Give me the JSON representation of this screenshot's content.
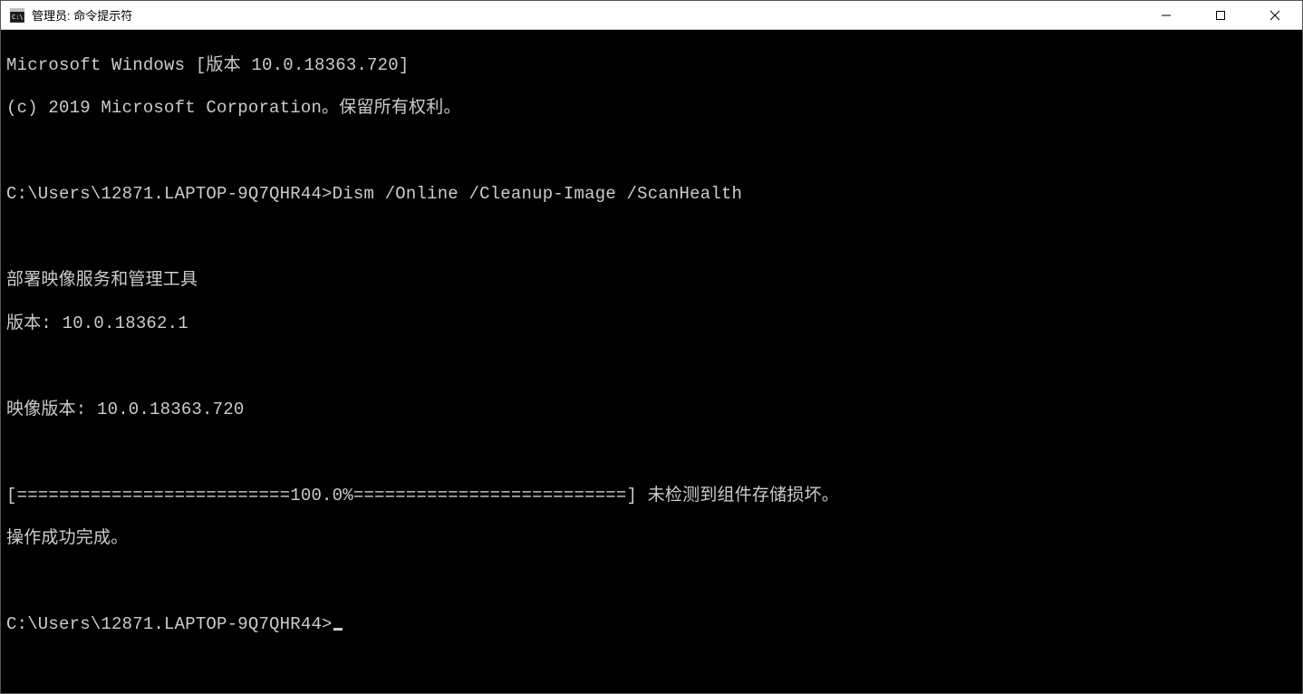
{
  "titlebar": {
    "title": "管理员: 命令提示符"
  },
  "terminal": {
    "lines": {
      "l0": "Microsoft Windows [版本 10.0.18363.720]",
      "l1": "(c) 2019 Microsoft Corporation。保留所有权利。",
      "l2": "",
      "l3_prompt": "C:\\Users\\12871.LAPTOP-9Q7QHR44>",
      "l3_cmd": "Dism /Online /Cleanup-Image /ScanHealth",
      "l4": "",
      "l5": "部署映像服务和管理工具",
      "l6": "版本: 10.0.18362.1",
      "l7": "",
      "l8": "映像版本: 10.0.18363.720",
      "l9": "",
      "l10": "[==========================100.0%==========================] 未检测到组件存储损坏。",
      "l11": "操作成功完成。",
      "l12": "",
      "l13_prompt": "C:\\Users\\12871.LAPTOP-9Q7QHR44>"
    }
  }
}
